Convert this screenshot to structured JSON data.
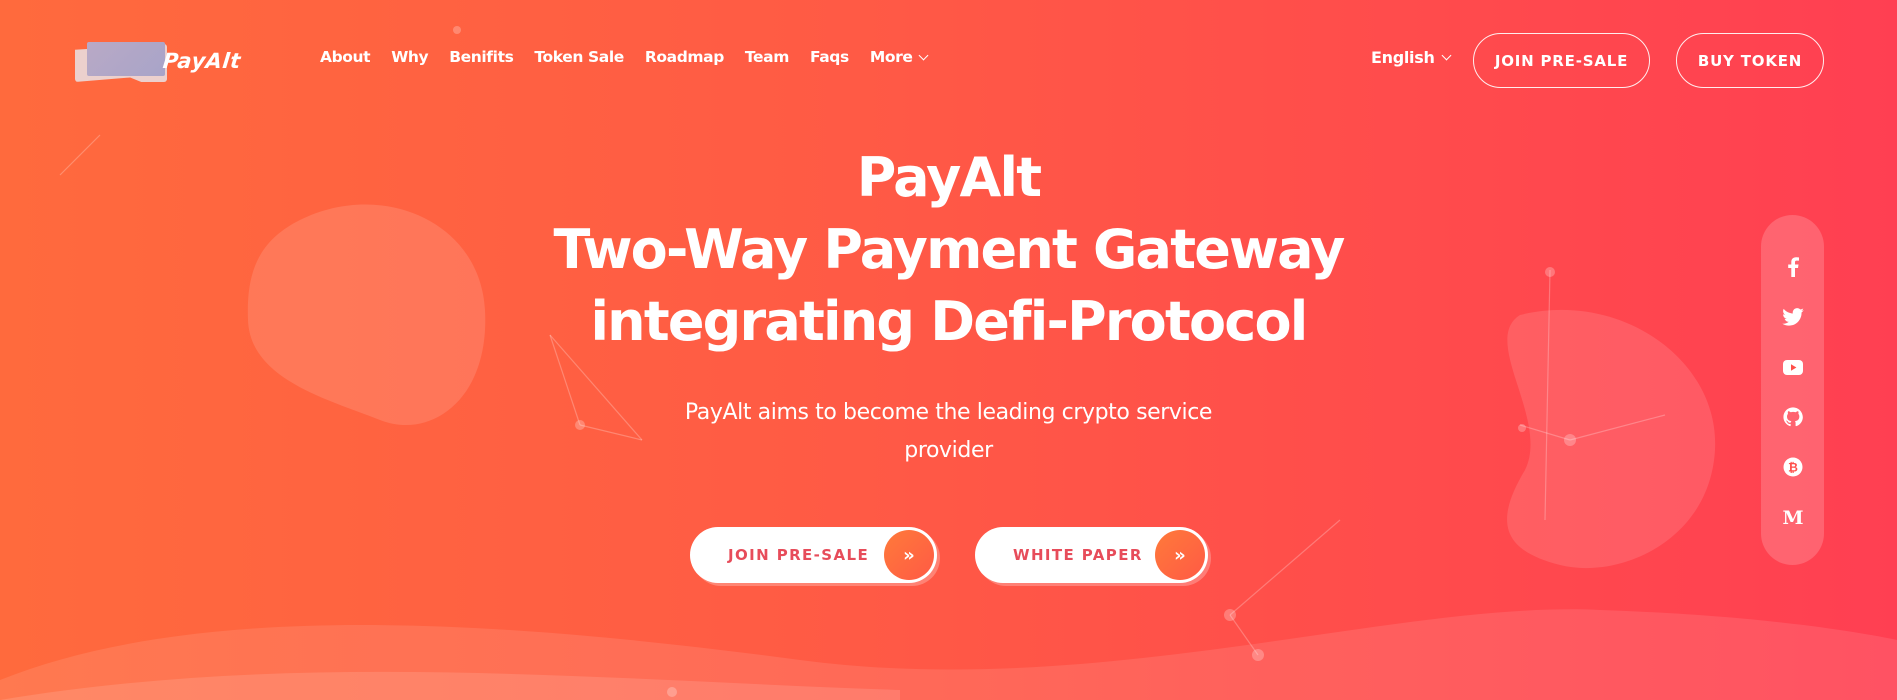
{
  "brand": {
    "name": "PayAlt"
  },
  "nav": {
    "items": [
      "About",
      "Why",
      "Benifits",
      "Token Sale",
      "Roadmap",
      "Team",
      "Faqs",
      "More"
    ]
  },
  "header": {
    "language": "English",
    "join_presale": "JOIN PRE-SALE",
    "buy_token": "BUY TOKEN"
  },
  "hero": {
    "title_line1": "PayAlt",
    "title_line2": "Two-Way Payment Gateway",
    "title_line3": "integrating Defi-Protocol",
    "subtitle_line1": "PayAlt aims to become the leading crypto service",
    "subtitle_line2": "provider",
    "cta_join": "JOIN PRE-SALE",
    "cta_whitepaper": "WHITE PAPER"
  },
  "social": [
    "facebook-icon",
    "twitter-icon",
    "youtube-icon",
    "github-icon",
    "bitcoin-icon",
    "medium-icon"
  ],
  "colors": {
    "gradient_start": "#ff6a3d",
    "gradient_end": "#ff3f52",
    "cta_text": "#e74c5a",
    "accent": "#ff7a3a"
  }
}
